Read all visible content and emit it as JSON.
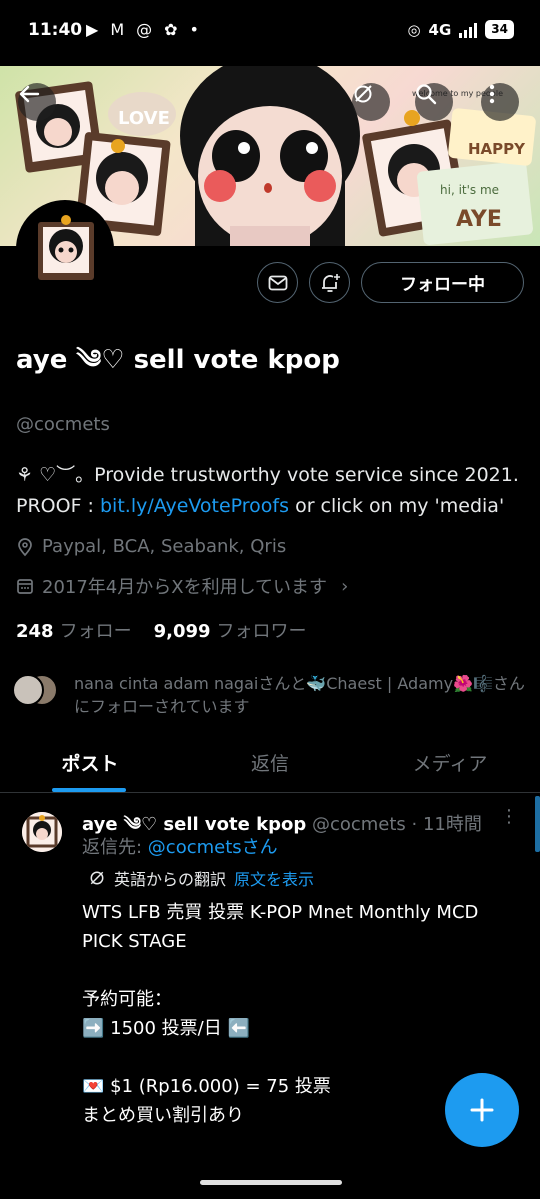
{
  "status_bar": {
    "time": "11:40",
    "network": "4G",
    "battery": "34",
    "left_icons": [
      "play-icon",
      "gmail-icon",
      "threads-icon",
      "notification-icon",
      "dot-icon"
    ]
  },
  "banner": {
    "art_text_love": "LOVE",
    "art_text_happy": "HAPPY",
    "art_text_hi": "hi, it's me",
    "art_text_name": "AYE",
    "art_text_welcome": "welcome to my people"
  },
  "profile": {
    "follow_button": "フォロー中",
    "name": "aye ༄♡ sell vote kpop",
    "handle": "@cocmets",
    "bio_line1": "⚘ ♡︶。Provide trustworthy vote service since 2021.",
    "bio_proof_prefix": "PROOF : ",
    "bio_link": "bit.ly/AyeVoteProofs",
    "bio_suffix": " or click on my 'media'",
    "location": "Paypal, BCA, Seabank, Qris",
    "joined": "2017年4月からXを利用しています",
    "following_count": "248",
    "following_label": "フォロー",
    "followers_count": "9,099",
    "followers_label": "フォロワー",
    "followed_by": "nana cinta adam nagaiさんと🐳Chaest | Adamy🌺🎼さんにフォローされています"
  },
  "tabs": [
    {
      "label": "ポスト",
      "active": true
    },
    {
      "label": "返信",
      "active": false
    },
    {
      "label": "メディア",
      "active": false
    }
  ],
  "tweet": {
    "name": "aye ༄♡ sell vote kpop",
    "handle_time": "@cocmets · 11時間",
    "reply_prefix": "返信先: ",
    "reply_handle": "@cocmetsさん",
    "translated_from": "英語からの翻訳",
    "show_original": "原文を表示",
    "body": "WTS LFB 売買 投票 K-POP Mnet Monthly MCD PICK STAGE\n\n予約可能：\n➡️ 1500 投票/日 ⬅️\n\n💌 $1 (Rp16.000) = 75 投票\nまとめ買い割引あり"
  },
  "colors": {
    "accent": "#1d9bf0",
    "muted": "#71767b",
    "background": "#000000"
  }
}
